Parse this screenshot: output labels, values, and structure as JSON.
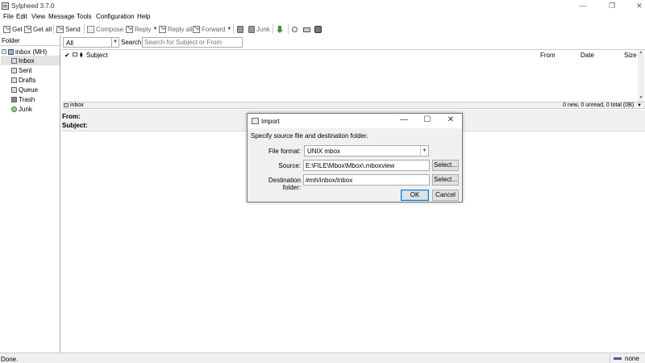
{
  "window": {
    "title": "Sylpheed 3.7.0",
    "min_glyph": "—",
    "max_glyph": "❐",
    "close_glyph": "✕"
  },
  "menu": [
    "File",
    "Edit",
    "View",
    "Message",
    "Tools",
    "Configuration",
    "Help"
  ],
  "toolbar": {
    "get": "Get",
    "get_all": "Get all",
    "send": "Send",
    "compose": "Compose",
    "reply": "Reply",
    "reply_all": "Reply all",
    "forward": "Forward",
    "junk": "Junk"
  },
  "folders": {
    "header": "Folder",
    "mailbox": "inbox (MH)",
    "items": [
      "Inbox",
      "Sent",
      "Drafts",
      "Queue",
      "Trash",
      "Junk"
    ],
    "selected": "Inbox"
  },
  "filter": {
    "select_value": "All",
    "search_label": "Search:",
    "search_placeholder": "Search for Subject or From"
  },
  "message_list": {
    "columns": {
      "check": "✔",
      "subject": "Subject",
      "from": "From",
      "date": "Date",
      "size": "Size"
    }
  },
  "status_line": {
    "folder": "inbox",
    "counts": "0 new, 0 unread, 0 total (0B)"
  },
  "message_header": {
    "from_label": "From:",
    "subject_label": "Subject:"
  },
  "statusbar": {
    "message": "Done.",
    "online": "none"
  },
  "dialog": {
    "title": "Import",
    "instruction": "Specify source file and destination folder.",
    "file_format_label": "File format:",
    "file_format_value": "UNIX mbox",
    "source_label": "Source:",
    "source_value": "E:\\FILE\\Mbox\\Mbox\\.mboxview",
    "dest_label": "Destination folder:",
    "dest_value": "#mh/inbox/inbox",
    "select_label": "Select...",
    "ok_label": "OK",
    "cancel_label": "Cancel"
  }
}
